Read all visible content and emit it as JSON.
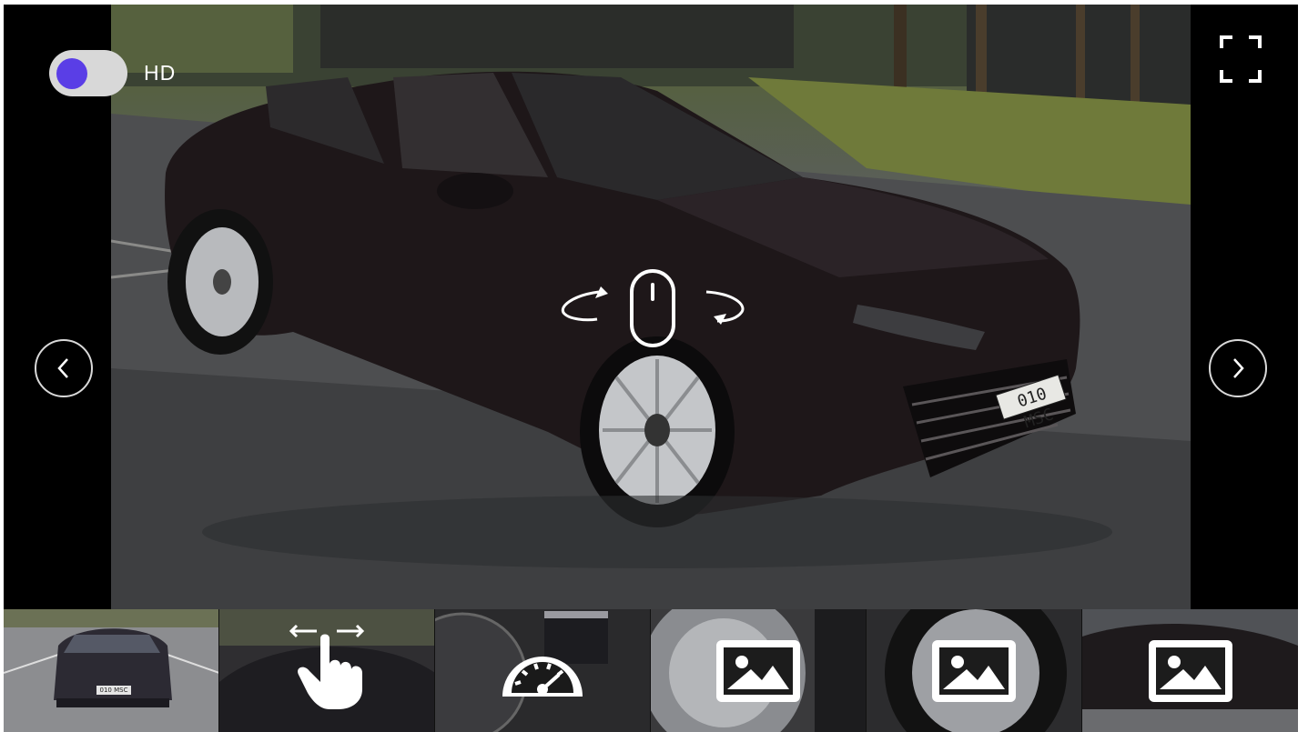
{
  "viewer": {
    "hd_toggle": {
      "label": "HD",
      "state": "on",
      "knob_color": "#5a3ee6"
    },
    "license_plate": "010 MSC",
    "rotate_hint_icons": [
      "rotate-left-icon",
      "mouse-icon",
      "rotate-right-icon"
    ],
    "nav": {
      "prev_icon": "chevron-left-icon",
      "next_icon": "chevron-right-icon"
    },
    "fullscreen_icon": "fullscreen-icon"
  },
  "thumbnails": [
    {
      "type": "exterior-photo",
      "plate": "010 MSC",
      "selected": true
    },
    {
      "type": "interior-360",
      "icon": "swipe-hand-icon"
    },
    {
      "type": "dashboard",
      "icon": "speedometer-icon"
    },
    {
      "type": "photo",
      "icon": "image-icon"
    },
    {
      "type": "photo",
      "icon": "image-icon"
    },
    {
      "type": "photo",
      "icon": "image-icon"
    }
  ],
  "colors": {
    "accent": "#5a3ee6",
    "background": "#000000",
    "icon": "#ffffff"
  }
}
